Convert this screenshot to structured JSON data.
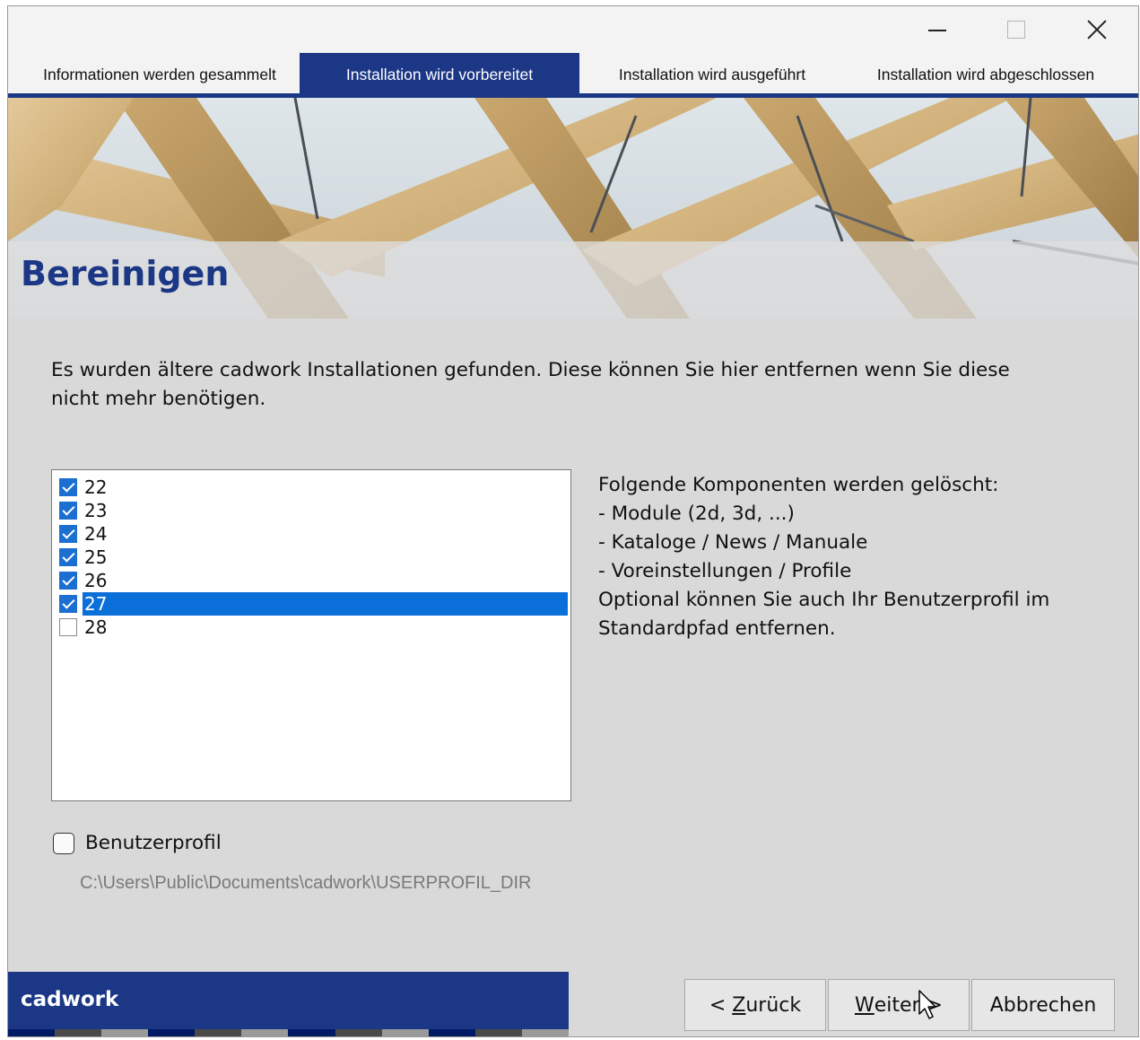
{
  "window": {
    "controls": {
      "minimize": "minimize-icon",
      "maximize": "maximize-icon",
      "close": "close-icon"
    }
  },
  "steps": [
    {
      "label": "Informationen werden gesammelt",
      "active": false
    },
    {
      "label": "Installation wird vorbereitet",
      "active": true
    },
    {
      "label": "Installation wird ausgeführt",
      "active": false
    },
    {
      "label": "Installation wird abgeschlossen",
      "active": false
    }
  ],
  "page": {
    "title": "Bereinigen"
  },
  "intro": {
    "line1": "Es wurden ältere cadwork Installationen gefunden. Diese können Sie hier entfernen wenn Sie diese",
    "line2": "nicht mehr benötigen."
  },
  "versions": [
    {
      "label": "22",
      "checked": true,
      "selected": false
    },
    {
      "label": "23",
      "checked": true,
      "selected": false
    },
    {
      "label": "24",
      "checked": true,
      "selected": false
    },
    {
      "label": "25",
      "checked": true,
      "selected": false
    },
    {
      "label": "26",
      "checked": true,
      "selected": false
    },
    {
      "label": "27",
      "checked": true,
      "selected": true
    },
    {
      "label": "28",
      "checked": false,
      "selected": false
    }
  ],
  "info": {
    "heading": "Folgende Komponenten werden gelöscht:",
    "items": [
      "- Module (2d, 3d, ...)",
      "- Kataloge / News / Manuale",
      "- Voreinstellungen / Profile"
    ],
    "note_line1": "Optional können Sie auch Ihr Benutzerprofil im",
    "note_line2": "Standardpfad entfernen."
  },
  "profile": {
    "label": "Benutzerprofil",
    "checked": false,
    "path": "C:\\Users\\Public\\Documents\\cadwork\\USERPROFIL_DIR"
  },
  "brand": {
    "name": "cadwork",
    "color": "#1b3785"
  },
  "buttons": {
    "back_prefix": "< ",
    "back_mnemonic": "Z",
    "back_rest": "urück",
    "next_mnemonic": "W",
    "next_rest": "eiter >",
    "cancel": "Abbrechen"
  },
  "colors": {
    "accent": "#1b3785",
    "selection": "#0a6fd8",
    "checkbox": "#1b6fd0"
  }
}
